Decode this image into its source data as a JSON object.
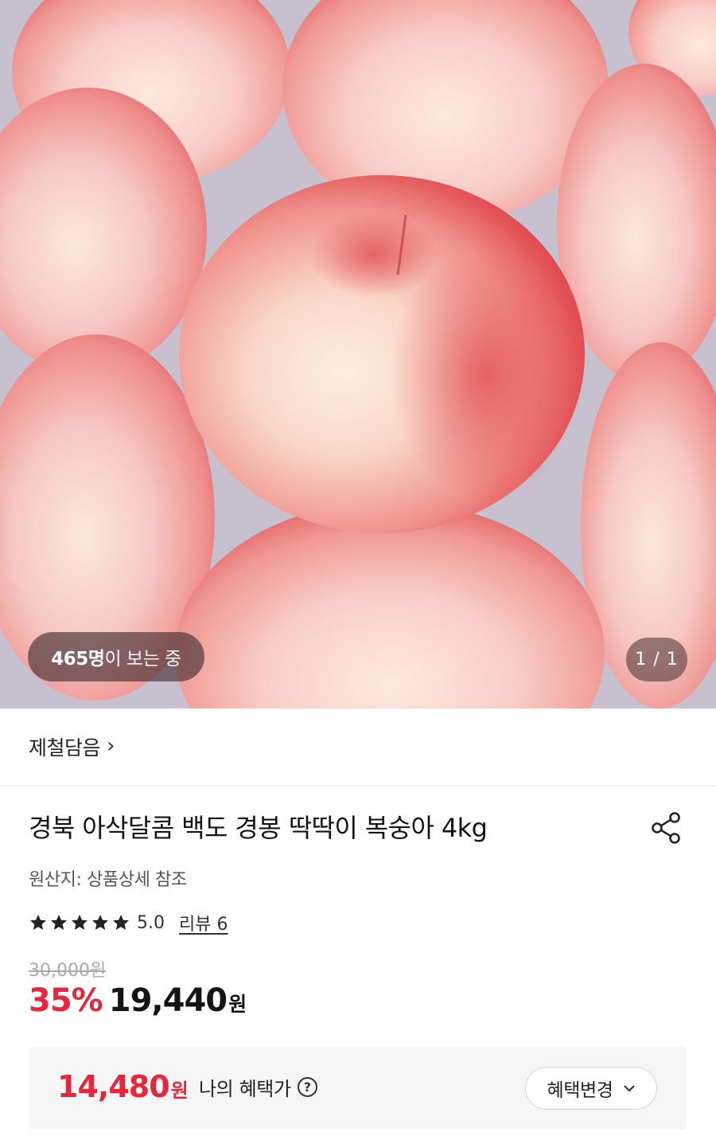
{
  "hero": {
    "image_alt": "peaches",
    "viewer_count": "465명",
    "viewer_suffix": "이 보는 중",
    "pager": "1 / 1"
  },
  "seller": {
    "name": "제철담음",
    "chevron": "›"
  },
  "product": {
    "title": "경북 아삭달콤 백도 경봉 딱딱이 복숭아 4kg",
    "origin": "원산지: 상품상세 참조",
    "rating": "5.0",
    "review_link": "리뷰 6",
    "original_price": "30,000원",
    "discount": "35%",
    "sale_price": "19,440",
    "currency": "원"
  },
  "benefit": {
    "price": "14,480",
    "currency": "원",
    "label": "나의 혜택가",
    "help_symbol": "?",
    "change_button": "혜택변경"
  },
  "colors": {
    "accent_red": "#e8263b",
    "peach_light": "#f6cfc9",
    "peach_red": "#e45a5d",
    "background": "#ffffff",
    "benefit_bg": "#f6f6f6"
  },
  "icons": [
    "share-icon",
    "star-icon",
    "help-icon",
    "chevron-down-icon",
    "chevron-right-icon"
  ]
}
